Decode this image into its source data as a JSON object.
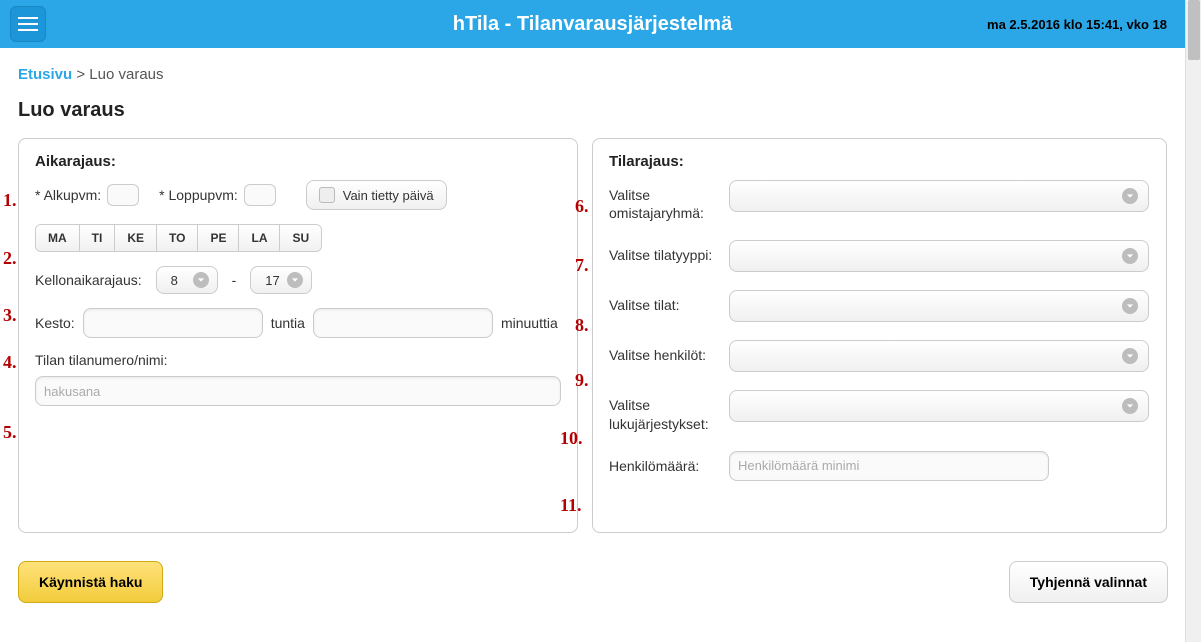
{
  "header": {
    "title": "hTila - Tilanvarausjärjestelmä",
    "datetime": "ma 2.5.2016 klo 15:41, vko 18"
  },
  "breadcrumb": {
    "home": "Etusivu",
    "sep": ">",
    "current": "Luo varaus"
  },
  "page_title": "Luo varaus",
  "left": {
    "title": "Aikarajaus:",
    "start_label": "* Alkupvm:",
    "end_label": "* Loppupvm:",
    "only_specific_day": "Vain tietty päivä",
    "weekdays": [
      "MA",
      "TI",
      "KE",
      "TO",
      "PE",
      "LA",
      "SU"
    ],
    "time_range_label": "Kellonaikarajaus:",
    "time_from": "8",
    "time_dash": "-",
    "time_to": "17",
    "duration_label": "Kesto:",
    "hours_label": "tuntia",
    "minutes_label": "minuuttia",
    "room_label": "Tilan tilanumero/nimi:",
    "room_placeholder": "hakusana"
  },
  "right": {
    "title": "Tilarajaus:",
    "owner_group": "Valitse omistajaryhmä:",
    "room_type": "Valitse tilatyyppi:",
    "rooms": "Valitse tilat:",
    "persons": "Valitse henkilöt:",
    "curricula": "Valitse lukujärjestykset:",
    "person_count": "Henkilömäärä:",
    "person_count_placeholder": "Henkilömäärä minimi"
  },
  "footer": {
    "start": "Käynnistä haku",
    "clear": "Tyhjennä valinnat"
  },
  "annotations": {
    "a1": "1.",
    "a2": "2.",
    "a3": "3.",
    "a4": "4.",
    "a5": "5.",
    "a6": "6.",
    "a7": "7.",
    "a8": "8.",
    "a9": "9.",
    "a10": "10.",
    "a11": "11."
  }
}
